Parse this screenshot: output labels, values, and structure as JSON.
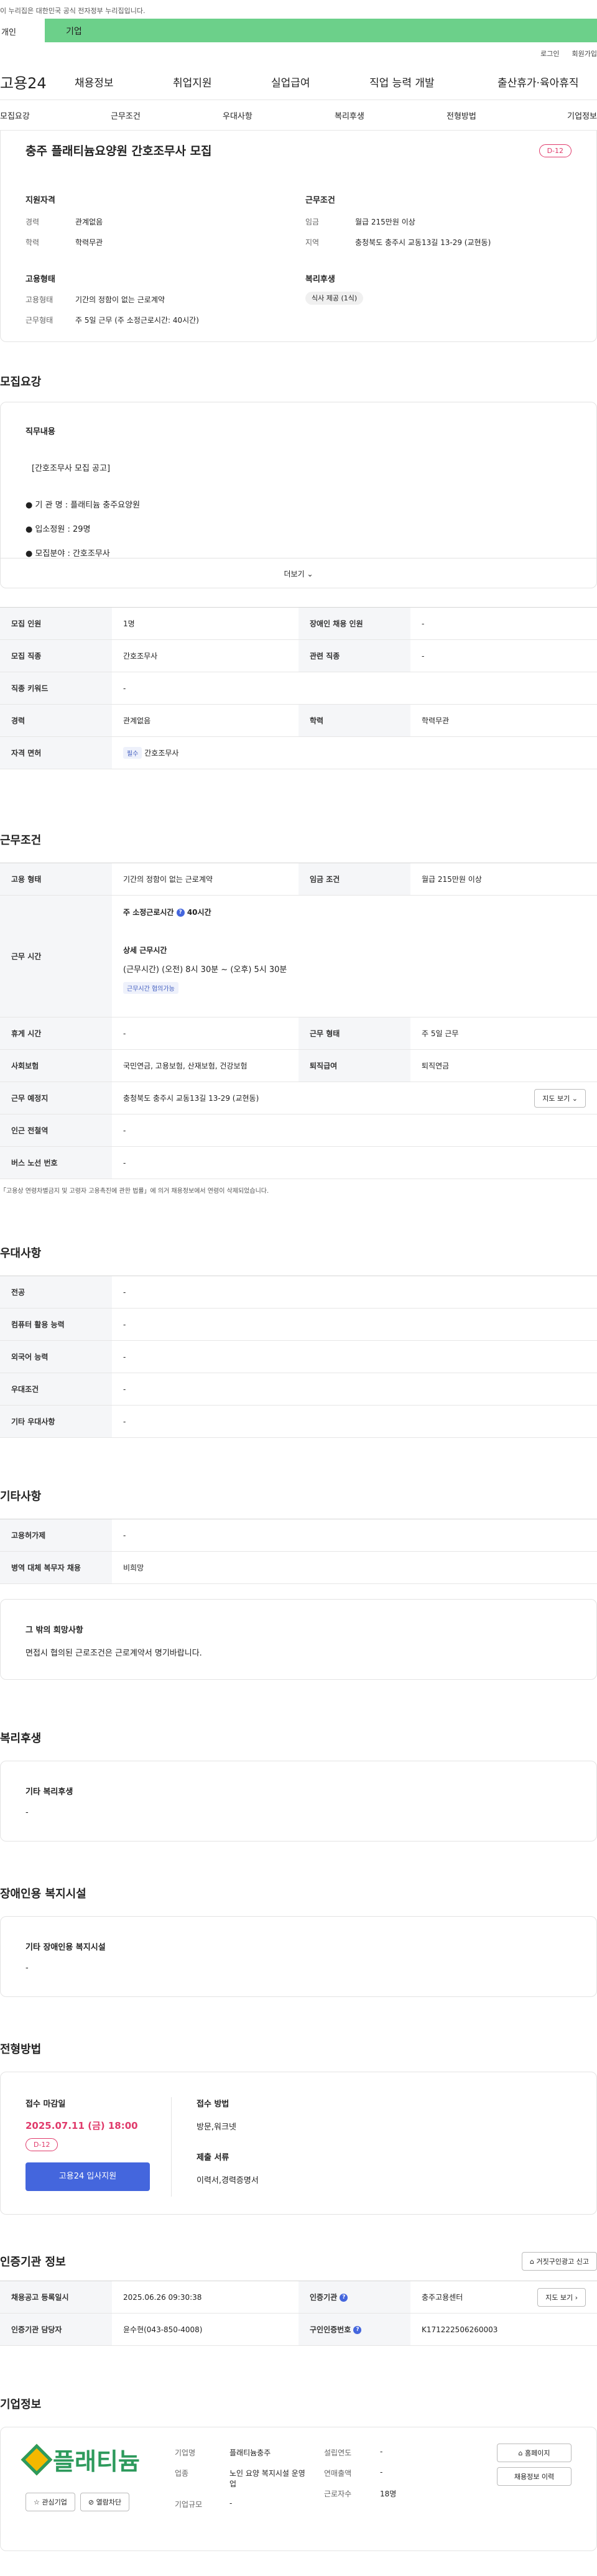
{
  "gov_notice": "이 누리집은 대한민국 공식 전자정부 누리집입니다.",
  "tabs": {
    "individual": "개인",
    "corporate": "기업"
  },
  "util": {
    "login": "로그인",
    "signup": "회원가입"
  },
  "gnb": {
    "logo": "고용24",
    "items": [
      "채용정보",
      "취업지원",
      "실업급여",
      "직업 능력 개발",
      "출산휴가·육아휴직"
    ]
  },
  "lnb": [
    "모집요강",
    "근무조건",
    "우대사항",
    "복리후생",
    "전형방법",
    "기업정보"
  ],
  "summary": {
    "title": "충주 플래티늄요양원 간호조무사 모집",
    "dday": "D-12",
    "qual_heading": "지원자격",
    "career_label": "경력",
    "career_value": "관계없음",
    "edu_label": "학력",
    "edu_value": "학력무관",
    "cond_heading": "근무조건",
    "wage_label": "임금",
    "wage_value": "월급 215만원 이상",
    "region_label": "지역",
    "region_value": "충청북도 충주시 교동13길 13-29 (교현동)",
    "emp_heading": "고용형태",
    "emp_type_label": "고용형태",
    "emp_type_value": "기간의 정함이 없는 근로계약",
    "work_type_label": "근무형태",
    "work_type_value": "주 5일 근무 (주 소정근로시간: 40시간)",
    "welfare_heading": "복리후생",
    "welfare_chip": "식사 제공 (1식)"
  },
  "recruit": {
    "heading": "모집요강",
    "duty_heading": "직무내용",
    "lines": [
      "[간호조무사 모집 공고]",
      "● 기 관 명 : 플래티늄 충주요양원",
      "● 입소정원 : 29명",
      "● 모집분야 : 간호조무사"
    ],
    "more": "더보기",
    "rows": [
      [
        "모집 인원",
        "1명",
        "장애인 채용 인원",
        "-"
      ],
      [
        "모집 직종",
        "간호조무사",
        "관련 직종",
        "-"
      ],
      [
        "직종 키워드",
        "-"
      ],
      [
        "경력",
        "관계없음",
        "학력",
        "학력무관"
      ],
      [
        "자격 면허",
        "간호조무사"
      ]
    ],
    "license_chip": "필수"
  },
  "work": {
    "heading": "근무조건",
    "emp_label": "고용 형태",
    "emp_value": "기간의 정함이 없는 근로계약",
    "wage_label": "임금 조건",
    "wage_value": "월급 215만원 이상",
    "hours_label": "근무 시간",
    "hours_main": "주 소정근로시간 ",
    "hours_main_value": "40시간",
    "hours_detail_heading": "상세 근무시간",
    "hours_detail": "(근무시간) (오전) 8시 30분 ~ (오후) 5시 30분",
    "hours_chip": "근무시간 협의가능",
    "rows": [
      [
        "휴게 시간",
        "-",
        "근무 형태",
        "주 5일 근무"
      ],
      [
        "사회보험",
        "국민연금, 고용보험, 산재보험, 건강보험",
        "퇴직급여",
        "퇴직연금"
      ]
    ],
    "place_label": "근무 예정지",
    "place_value": "충청북도 충주시 교동13길 13-29 (교현동)",
    "map_btn": "지도 보기",
    "rows2": [
      [
        "인근 전철역",
        "-"
      ],
      [
        "버스 노선 번호",
        "-"
      ]
    ],
    "note": "「고용상 연령차별금지 및 고령자 고용촉진에 관한 법률」에 의거 채용정보에서 연령이 삭제되었습니다."
  },
  "pref": {
    "heading": "우대사항",
    "rows": [
      [
        "전공",
        "-"
      ],
      [
        "컴퓨터 활용 능력",
        "-"
      ],
      [
        "외국어 능력",
        "-"
      ],
      [
        "우대조건",
        "-"
      ],
      [
        "기타 우대사항",
        "-"
      ]
    ]
  },
  "etc": {
    "heading": "기타사항",
    "rows": [
      [
        "고용허가제",
        "-"
      ],
      [
        "병역 대체 복무자 채용",
        "비희망"
      ]
    ],
    "box_title": "그 밖의 희망사항",
    "box_text": "면접시 협의된 근로조건은 근로계약서 명기바랍니다."
  },
  "welfare": {
    "heading": "복리후생",
    "box_title": "기타 복리후생",
    "box_text": "-"
  },
  "disabled": {
    "heading": "장애인용 복지시설",
    "box_title": "기타 장애인용 복지시설",
    "box_text": "-"
  },
  "process": {
    "heading": "전형방법",
    "deadline_label": "접수 마감일",
    "deadline": "2025.07.11 (금) 18:00",
    "dday": "D-12",
    "apply_btn": "고용24 입사지원",
    "method_label": "접수 방법",
    "method": "방문,워크넷",
    "docs_label": "제출 서류",
    "docs": "이력서,경력증명서"
  },
  "agency": {
    "heading": "인증기관 정보",
    "report_btn": "거짓구인광고 신고",
    "rows": [
      [
        "채용공고 등록일시",
        "2025.06.26 09:30:38",
        "인증기관",
        "충주고용센터"
      ],
      [
        "인증기관 담당자",
        "윤수현(043-850-4008)",
        "구인인증번호",
        "K171222506260003"
      ]
    ],
    "map_btn": "지도 보기"
  },
  "company": {
    "heading": "기업정보",
    "logo_text": "플래티늄",
    "fav_btn": "관심기업",
    "block_btn": "열람차단",
    "fields": [
      [
        "기업명",
        "플래티늄충주"
      ],
      [
        "업종",
        "노인 요양 복지시설 운영업"
      ],
      [
        "기업규모",
        "-"
      ]
    ],
    "fields2": [
      [
        "설립연도",
        "-"
      ],
      [
        "연매출액",
        "-"
      ],
      [
        "근로자수",
        "18명"
      ]
    ],
    "home_btn": "홈페이지",
    "jobs_btn": "채용정보 이력"
  },
  "colors": {
    "green": "#6cd08a",
    "blue": "#4466dd",
    "pink": "#e03a6b"
  }
}
